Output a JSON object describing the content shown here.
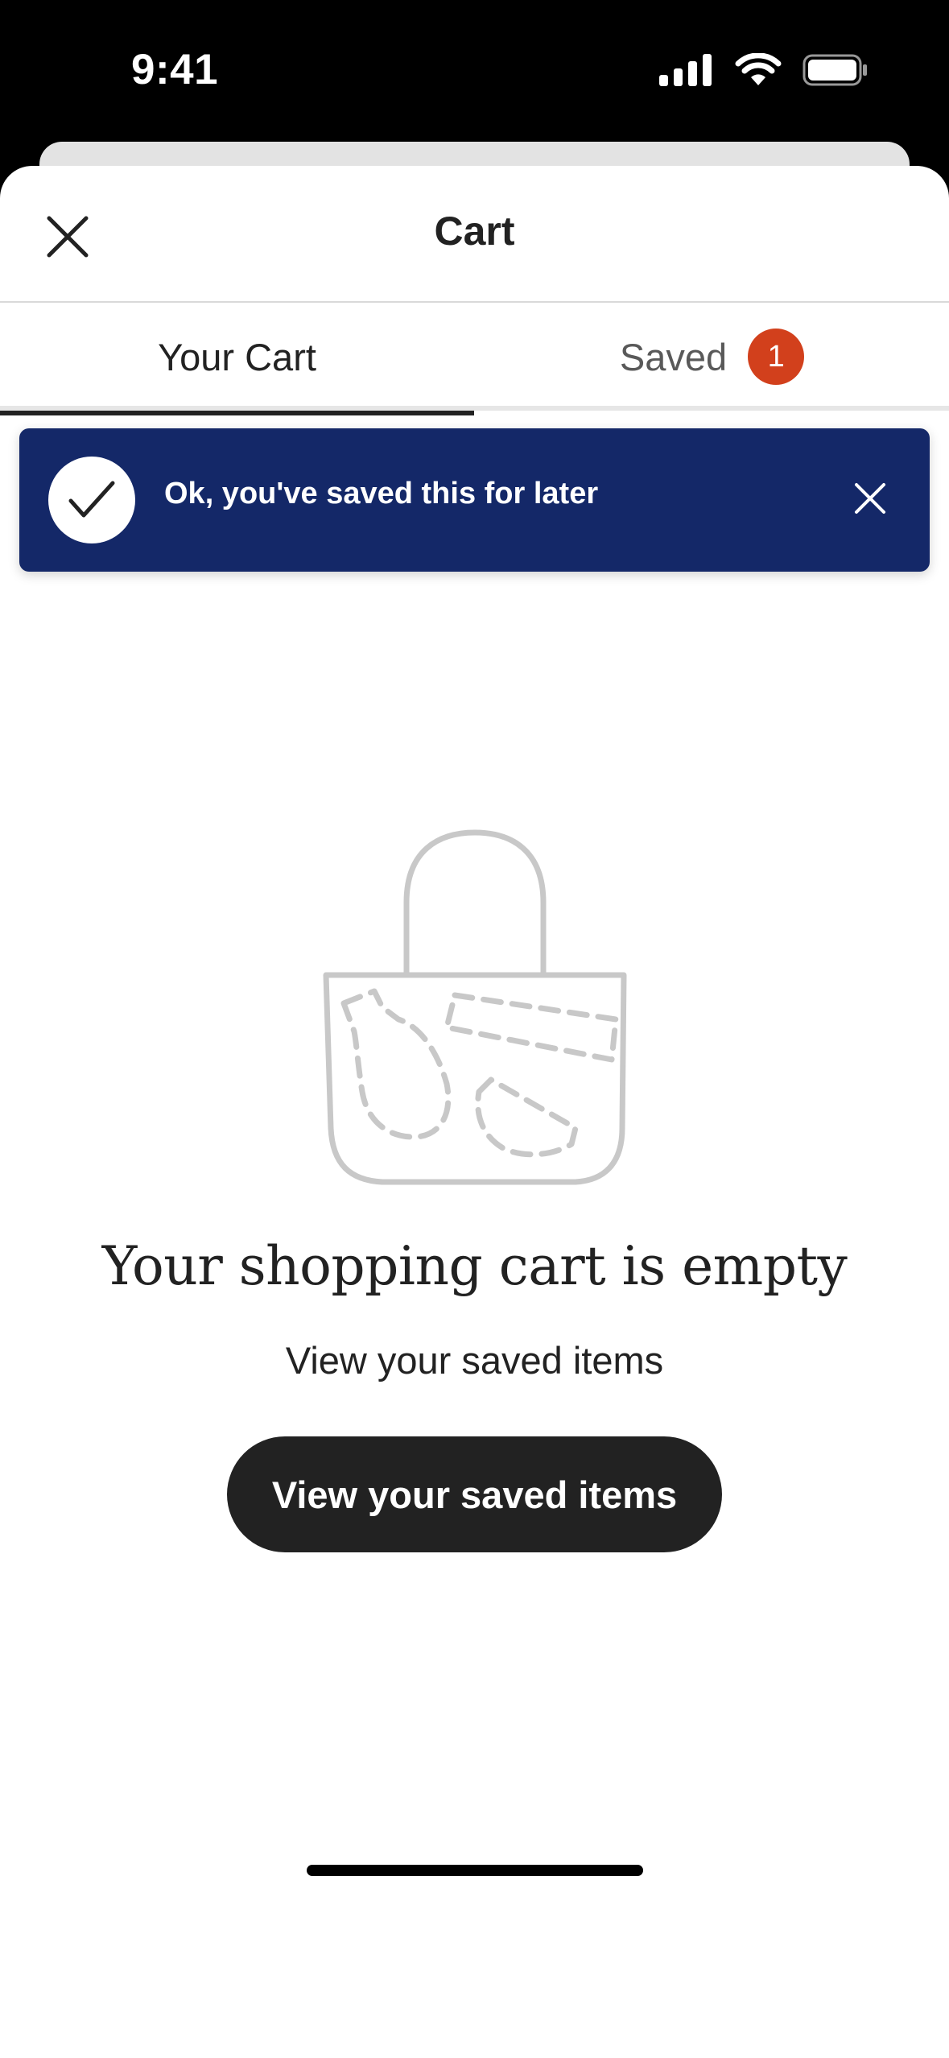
{
  "status_bar": {
    "time": "9:41",
    "icons": [
      "cellular-signal-icon",
      "wifi-icon",
      "battery-icon"
    ]
  },
  "header": {
    "title": "Cart",
    "close_icon": "close-icon"
  },
  "tabs": [
    {
      "label": "Your Cart",
      "active": true
    },
    {
      "label": "Saved",
      "active": false,
      "badge": "1"
    }
  ],
  "toast": {
    "message": "Ok, you've saved this for later",
    "icon": "checkmark-icon",
    "close_icon": "close-icon"
  },
  "empty_state": {
    "illustration": "shopping-bag-icon",
    "title": "Your shopping cart is empty",
    "subtitle": "View your saved items",
    "button_label": "View your saved items"
  },
  "colors": {
    "toast_background": "#142868",
    "badge": "#d2401c",
    "button": "#222222",
    "text": "#222222"
  }
}
